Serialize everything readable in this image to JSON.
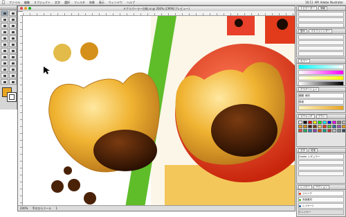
{
  "menubar": {
    "items": [
      "ファイル",
      "編集",
      "オブジェクト",
      "文字",
      "選択",
      "フィルタ",
      "効果",
      "表示",
      "ウィンドウ",
      "ヘルプ"
    ],
    "clock": "16:11",
    "user": "AM",
    "doc_hint": "Adobe Illustrator"
  },
  "document": {
    "title": "ドナツパーラー白地.ai @ 200% (CMYK/プレビュー)",
    "zoom": "200%",
    "status": "手のひらツール",
    "page": "1"
  },
  "palettes": {
    "top_tabs": [
      "ナビゲーター",
      "情報"
    ],
    "align_tabs": [
      "整列",
      "パスファインダー"
    ],
    "color_tabs": [
      "カラー",
      "グラデーション"
    ],
    "gradient_labels": [
      "種類",
      "角度",
      "位置"
    ],
    "gradient_type": "線形",
    "swatch_tabs": [
      "スウォッチ",
      "ブラシ",
      "シンボル"
    ],
    "char_tabs": [
      "文字",
      "段落"
    ],
    "char_font": "Osaka",
    "char_style": "レギュラー",
    "layer_tabs": [
      "レイヤー",
      "アクション"
    ],
    "layers": [
      "ジャンク",
      "背景素材",
      "レイヤー1"
    ],
    "layer_count": "3 レイヤー"
  },
  "colors": {
    "accent_fill": "#e8a522",
    "donut_gold": "#f0b331",
    "chocolate": "#4a2208",
    "green_stripe": "#5fbd2a",
    "tomato_red": "#e23b1c"
  },
  "swatch_colors": [
    "#ffffff",
    "#000000",
    "#ff0000",
    "#ffff00",
    "#00ff00",
    "#00ffff",
    "#0000ff",
    "#ff00ff",
    "#808080",
    "#c0c0c0",
    "#e8a522",
    "#d4901a",
    "#4a2208",
    "#7a3b10",
    "#f5d26a",
    "#e23b1c",
    "#5fbd2a",
    "#2d6a9f",
    "#9b59b6",
    "#f39c12",
    "#e74c3c",
    "#27ae60",
    "#2980b9",
    "#8e44ad",
    "#d35400",
    "#16a085",
    "#c0392b",
    "#bdc3c7",
    "#7f8c8d",
    "#34495e"
  ]
}
